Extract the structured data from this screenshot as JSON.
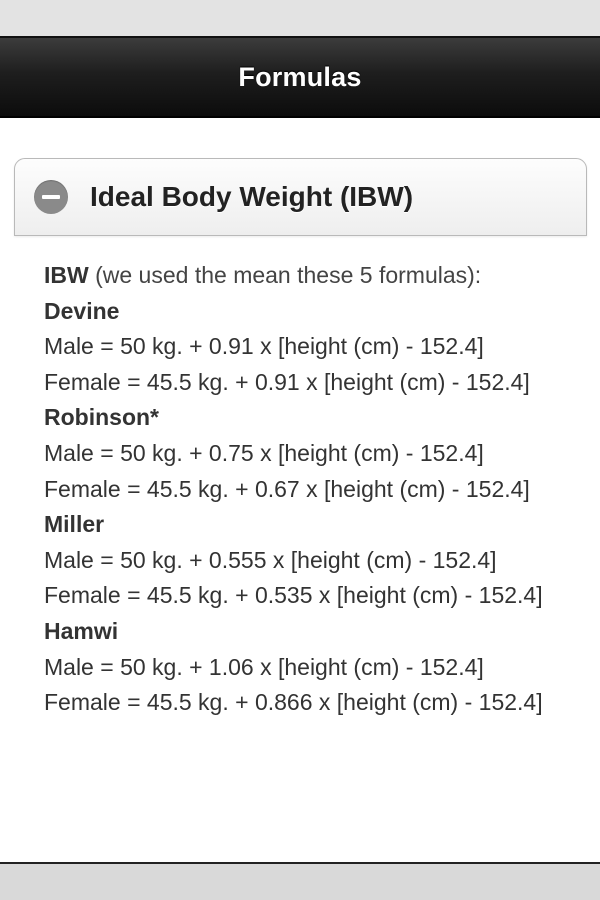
{
  "header": {
    "title": "Formulas"
  },
  "section": {
    "title": "Ideal Body Weight (IBW)",
    "intro_bold": "IBW",
    "intro_text": " (we used the mean these 5 formulas):",
    "formulas": [
      {
        "name": "Devine",
        "male": "Male = 50 kg. + 0.91 x [height (cm) - 152.4]",
        "female": "Female = 45.5 kg. + 0.91 x [height (cm) - 152.4]"
      },
      {
        "name": "Robinson*",
        "male": "Male = 50 kg. + 0.75 x [height (cm) - 152.4]",
        "female": "Female = 45.5 kg. + 0.67 x [height (cm) - 152.4]"
      },
      {
        "name": "Miller",
        "male": "Male = 50 kg. + 0.555 x [height (cm) - 152.4]",
        "female": "Female = 45.5 kg. + 0.535 x [height (cm) - 152.4]"
      },
      {
        "name": "Hamwi",
        "male": "Male = 50 kg. + 1.06 x [height (cm) - 152.4]",
        "female": "Female = 45.5 kg. + 0.866 x [height (cm) - 152.4]"
      }
    ]
  },
  "icons": {
    "collapse": "minus-circle-icon"
  },
  "colors": {
    "header_bg": "#1e1e1e",
    "icon_bg": "#8a8a8a"
  }
}
